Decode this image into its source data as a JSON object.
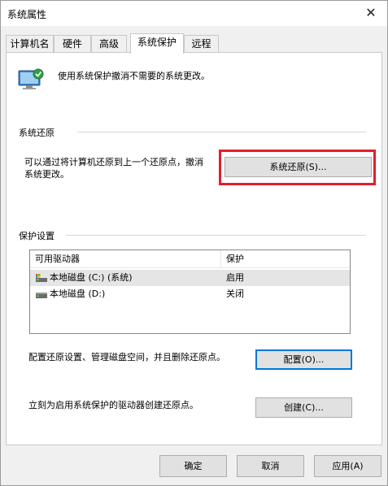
{
  "window": {
    "title": "系统属性",
    "close_glyph": "✕"
  },
  "tabs": [
    {
      "label": "计算机名",
      "active": false
    },
    {
      "label": "硬件",
      "active": false
    },
    {
      "label": "高级",
      "active": false
    },
    {
      "label": "系统保护",
      "active": true
    },
    {
      "label": "远程",
      "active": false
    }
  ],
  "header": {
    "icon": "system-protection-icon",
    "description": "使用系统保护撤消不需要的系统更改。"
  },
  "system_restore": {
    "group_label": "系统还原",
    "description_line1": "可以通过将计算机还原到上一个还原点，撤消",
    "description_line2": "系统更改。",
    "button_label": "系统还原(S)...",
    "highlight_color": "#e21d2a"
  },
  "protection_settings": {
    "group_label": "保护设置",
    "columns": [
      "可用驱动器",
      "保护"
    ],
    "rows": [
      {
        "drive": "本地磁盘 (C:) (系统)",
        "protection": "启用",
        "icon": "system-drive-icon",
        "selected": true
      },
      {
        "drive": "本地磁盘 (D:)",
        "protection": "关闭",
        "icon": "drive-icon",
        "selected": false
      }
    ],
    "configure_text": "配置还原设置、管理磁盘空间，并且删除还原点。",
    "configure_button": "配置(O)...",
    "create_text": "立刻为启用系统保护的驱动器创建还原点。",
    "create_button": "创建(C)..."
  },
  "footer": {
    "ok": "确定",
    "cancel": "取消",
    "apply": "应用(A)"
  },
  "colors": {
    "accent": "#0078d7",
    "panel_bg": "#ffffff",
    "window_bg": "#f0f0f0"
  }
}
